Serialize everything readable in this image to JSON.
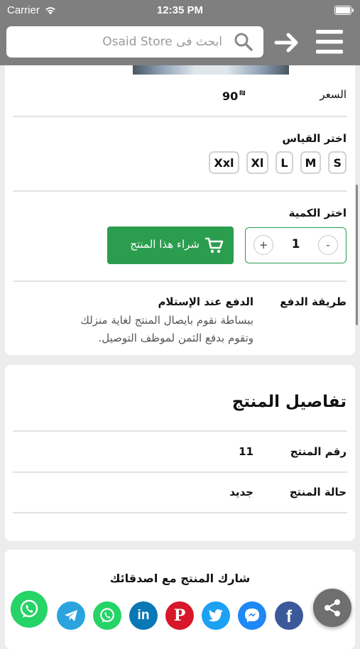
{
  "status_bar": {
    "carrier": "Carrier",
    "time": "12:35 PM"
  },
  "header": {
    "search_placeholder": "ابحث فى Osaid Store"
  },
  "product": {
    "price_label": "السعر",
    "price_value": "90",
    "currency_symbol": "₪",
    "size_label": "اختر القياس",
    "sizes": [
      "Xxl",
      "Xl",
      "L",
      "M",
      "S"
    ],
    "quantity_label": "اختر الكمية",
    "quantity": "1",
    "plus": "+",
    "minus": "-",
    "buy_button": "شراء هذا المنتج",
    "payment_label": "طريقة الدفع",
    "payment_method": "الدفع عند الإستلام",
    "payment_desc_1": "ببساطة نقوم بايصال المنتج لغاية منزلك",
    "payment_desc_2": "وتقوم بدفع الثمن لموظف التوصيل."
  },
  "details": {
    "title": "تفاصيل المنتج",
    "number_label": "رقم المنتج",
    "number_value": "11",
    "condition_label": "حالة المنتج",
    "condition_value": "جديد"
  },
  "share": {
    "title": "شارك المنتج مع اصدقائك",
    "networks": [
      "whatsapp",
      "telegram",
      "whatsapp",
      "linkedin",
      "pinterest",
      "twitter",
      "messenger",
      "facebook"
    ]
  },
  "colors": {
    "header_gray": "#7f7f7f",
    "buy_green": "#2a9d4f",
    "whatsapp": "#25d366",
    "telegram": "#2aa3df",
    "linkedin": "#0a78b5",
    "pinterest": "#d7182a",
    "twitter": "#1da1f2",
    "messenger": "#1e88f5",
    "facebook": "#3b5998"
  }
}
